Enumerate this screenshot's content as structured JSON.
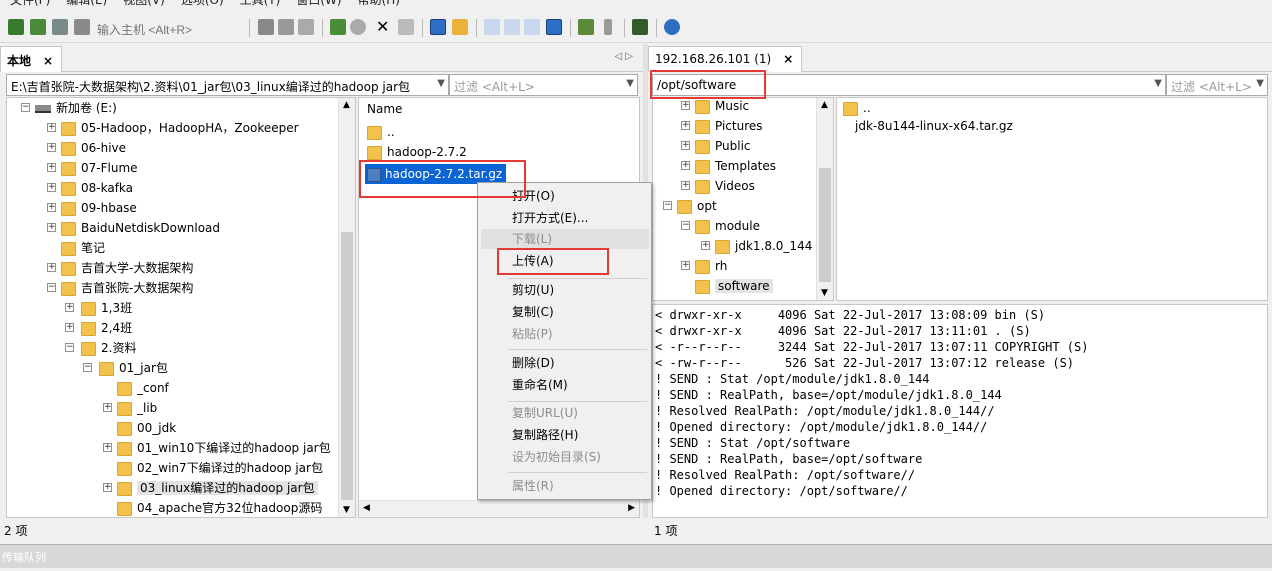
{
  "menubar": {
    "items": [
      "文件(F)",
      "编辑(E)",
      "视图(V)",
      "选项(O)",
      "工具(T)",
      "窗口(W)",
      "帮助(H)"
    ]
  },
  "toolbar": {
    "host_placeholder": "输入主机 <Alt+R>"
  },
  "local": {
    "tab_label": "本地",
    "tab_close": "×",
    "nav_arrows": "◁  ▷",
    "path": "E:\\吉首张院-大数据架构\\2.资料\\01_jar包\\03_linux编译过的hadoop jar包",
    "filter_placeholder": "过滤 <Alt+L>",
    "tree": [
      {
        "label": "新加卷 (E:)",
        "type": "drive"
      },
      {
        "label": "05-Hadoop，HadoopHA，Zookeeper"
      },
      {
        "label": "06-hive"
      },
      {
        "label": "07-Flume"
      },
      {
        "label": "08-kafka"
      },
      {
        "label": "09-hbase"
      },
      {
        "label": "BaiduNetdiskDownload"
      },
      {
        "label": "笔记"
      },
      {
        "label": "吉首大学-大数据架构"
      },
      {
        "label": "吉首张院-大数据架构"
      },
      {
        "label": "1,3班"
      },
      {
        "label": "2,4班"
      },
      {
        "label": "2.资料"
      },
      {
        "label": "01_jar包"
      },
      {
        "label": "_conf"
      },
      {
        "label": "_lib"
      },
      {
        "label": "00_jdk"
      },
      {
        "label": "01_win10下编译过的hadoop jar包"
      },
      {
        "label": "02_win7下编译过的hadoop jar包"
      },
      {
        "label": "03_linux编译过的hadoop jar包"
      },
      {
        "label": "04_apache官方32位hadoop源码"
      }
    ],
    "file_header": "Name",
    "files": [
      "..",
      "hadoop-2.7.2",
      "hadoop-2.7.2.tar.gz"
    ],
    "status": "2 项"
  },
  "remote": {
    "tab_label": "192.168.26.101 (1)",
    "tab_close": "×",
    "path": "/opt/software",
    "filter_placeholder": "过滤 <Alt+L>",
    "tree": [
      {
        "label": "Music"
      },
      {
        "label": "Pictures"
      },
      {
        "label": "Public"
      },
      {
        "label": "Templates"
      },
      {
        "label": "Videos"
      },
      {
        "label": "opt"
      },
      {
        "label": "module"
      },
      {
        "label": "jdk1.8.0_144"
      },
      {
        "label": "rh"
      },
      {
        "label": "software"
      }
    ],
    "files": [
      "..",
      "jdk-8u144-linux-x64.tar.gz"
    ],
    "log": [
      "< drwxr-xr-x     4096 Sat 22-Jul-2017 13:08:09 bin (S)",
      "< drwxr-xr-x     4096 Sat 22-Jul-2017 13:11:01 . (S)",
      "< -r--r--r--     3244 Sat 22-Jul-2017 13:07:11 COPYRIGHT (S)",
      "< -rw-r--r--      526 Sat 22-Jul-2017 13:07:12 release (S)",
      "! SEND : Stat /opt/module/jdk1.8.0_144",
      "! SEND : RealPath, base=/opt/module/jdk1.8.0_144",
      "! Resolved RealPath: /opt/module/jdk1.8.0_144//",
      "! Opened directory: /opt/module/jdk1.8.0_144//",
      "! SEND : Stat /opt/software",
      "! SEND : RealPath, base=/opt/software",
      "! Resolved RealPath: /opt/software//",
      "! Opened directory: /opt/software//"
    ],
    "status": "1 项"
  },
  "context_menu": {
    "items": [
      {
        "label": "打开(O)",
        "enabled": true
      },
      {
        "label": "打开方式(E)...",
        "enabled": true
      },
      {
        "label": "下载(L)",
        "enabled": false
      },
      {
        "label": "上传(A)",
        "enabled": true
      },
      {
        "label": "剪切(U)",
        "enabled": true
      },
      {
        "label": "复制(C)",
        "enabled": true
      },
      {
        "label": "粘贴(P)",
        "enabled": false
      },
      {
        "label": "删除(D)",
        "enabled": true
      },
      {
        "label": "重命名(M)",
        "enabled": true
      },
      {
        "label": "复制URL(U)",
        "enabled": false
      },
      {
        "label": "复制路径(H)",
        "enabled": true
      },
      {
        "label": "设为初始目录(S)",
        "enabled": false
      },
      {
        "label": "属性(R)",
        "enabled": false
      }
    ]
  },
  "queue_bar": {
    "label": "传输队列"
  },
  "colors": {
    "selection": "#0a64d4",
    "highlight_box": "#e53935",
    "folder": "#f3c24c"
  }
}
